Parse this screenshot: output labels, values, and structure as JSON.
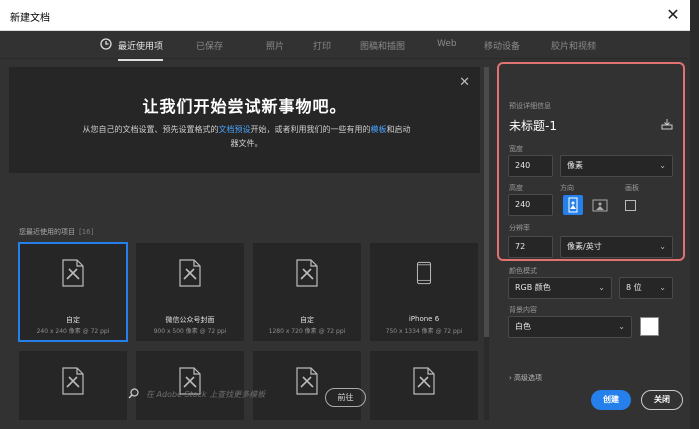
{
  "window": {
    "title": "新建文档"
  },
  "tabs": [
    "最近使用项",
    "已保存",
    "照片",
    "打印",
    "图稿和插图",
    "Web",
    "移动设备",
    "胶片和视频"
  ],
  "banner": {
    "headline": "让我们开始尝试新事物吧。",
    "desc_part1": "从您自己的文档设置、预先设置格式的",
    "desc_link1": "文档预设",
    "desc_part2": "开始，或者利用我们的一些有用的",
    "desc_link2": "模板",
    "desc_part3": "和启动器文件。"
  },
  "recent": {
    "label": "您最近使用的项目",
    "count": "[16]",
    "items": [
      {
        "name": "自定",
        "detail": "240 x 240 像素 @ 72 ppi"
      },
      {
        "name": "微信公众号封面",
        "detail": "900 x 500 像素 @ 72 ppi"
      },
      {
        "name": "自定",
        "detail": "1280 x 720 像素 @ 72 ppi"
      },
      {
        "name": "iPhone 6",
        "detail": "750 x 1334 像素 @ 72 ppi"
      }
    ]
  },
  "search": {
    "placeholder": "在 Adobe Stock 上查找更多模板",
    "go": "前往"
  },
  "preset": {
    "section_label": "预设详细信息",
    "doc_title": "未标题-1",
    "width_label": "宽度",
    "width": "240",
    "unit": "像素",
    "height_label": "高度",
    "height": "240",
    "orientation_label": "方向",
    "artboard_label": "画板",
    "resolution_label": "分辨率",
    "resolution": "72",
    "res_unit": "像素/英寸",
    "color_mode_label": "颜色模式",
    "color_mode": "RGB 颜色",
    "bit_depth": "8 位",
    "bg_label": "背景内容",
    "bg": "白色",
    "advanced": "高级选项"
  },
  "buttons": {
    "create": "创建",
    "close": "关闭"
  },
  "colors": {
    "accent": "#2680eb",
    "highlight": "#e07272"
  }
}
